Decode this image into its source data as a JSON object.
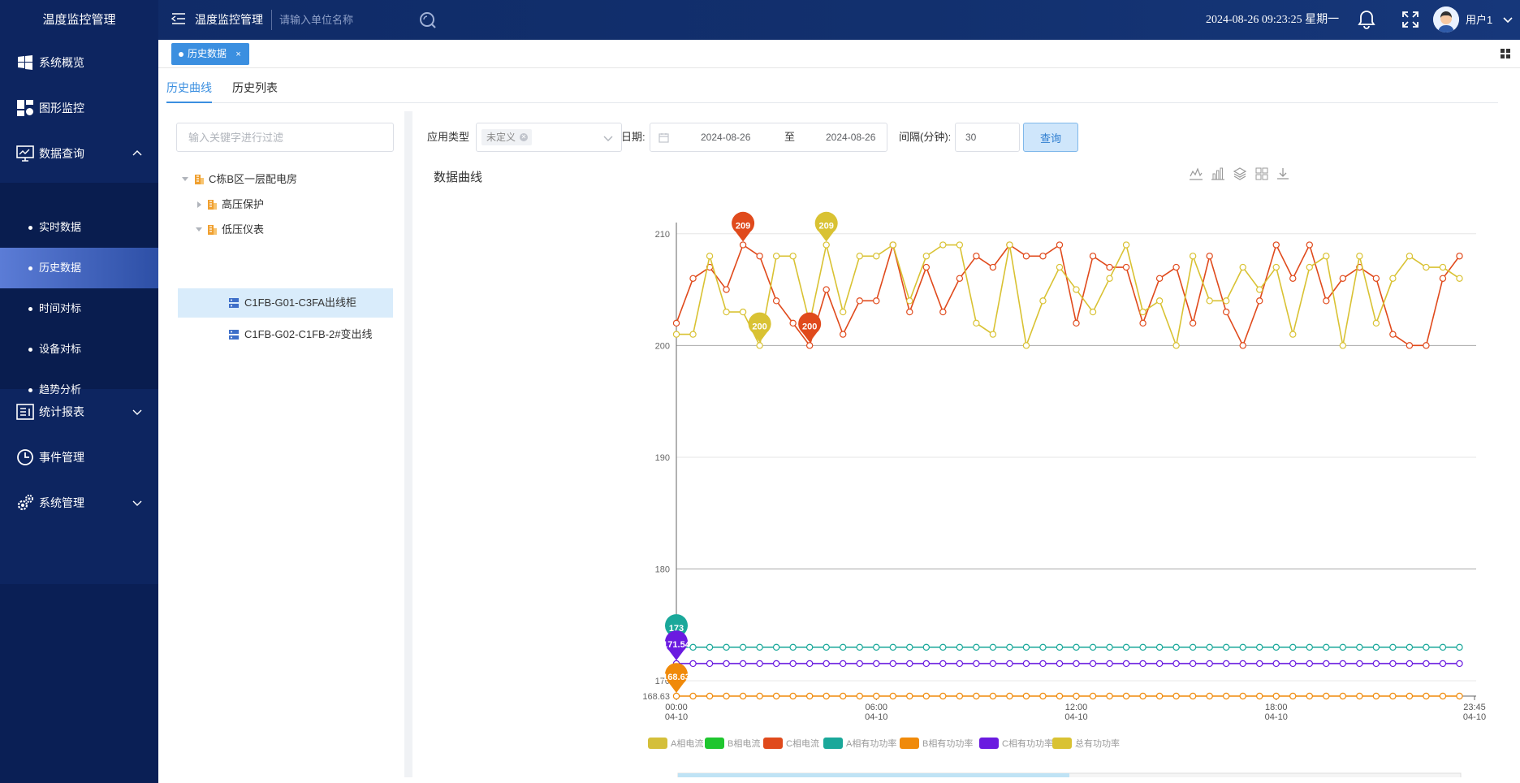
{
  "header": {
    "brand": "温度监控管理",
    "title": "温度监控管理",
    "search_placeholder": "请输入单位名称",
    "datetime": "2024-08-26 09:23:25 星期一",
    "user": "用户1"
  },
  "sidebar": {
    "items": [
      {
        "label": "系统概览",
        "icon": "windows-icon"
      },
      {
        "label": "图形监控",
        "icon": "dashboard-icon"
      },
      {
        "label": "数据查询",
        "icon": "monitor-icon"
      },
      {
        "label": "统计报表",
        "icon": "report-icon"
      },
      {
        "label": "事件管理",
        "icon": "clock-icon"
      },
      {
        "label": "系统管理",
        "icon": "gears-icon"
      }
    ],
    "subitems": [
      "实时数据",
      "历史数据",
      "时间对标",
      "设备对标",
      "趋势分析"
    ],
    "active_sub": 1
  },
  "tags": {
    "active": "历史数据",
    "close": "×"
  },
  "subtabs": [
    "历史曲线",
    "历史列表"
  ],
  "tree": {
    "filter_placeholder": "输入关键字进行过滤",
    "nodes": [
      "C栋B区一层配电房",
      "高压保护",
      "低压仪表",
      "C1FB-G01-C3FA出线柜",
      "C1FB-G02-C1FB-2#变出线"
    ]
  },
  "query": {
    "type_label": "应用类型",
    "type_value": "未定义",
    "date_label": "日期:",
    "date_start": "2024-08-26",
    "date_sep": "至",
    "date_end": "2024-08-26",
    "interval_label": "间隔(分钟):",
    "interval_value": "30",
    "button": "查询"
  },
  "chart_title": "数据曲线",
  "colors": {
    "a_current": "#d4bf3a",
    "b_current": "#1fc62f",
    "c_current": "#e04a1c",
    "a_power": "#1aa89a",
    "b_power": "#f08a0a",
    "c_power": "#6a1be0",
    "total_power": "#d9c233",
    "accent": "#3b8fe0"
  },
  "chart_data": {
    "type": "line",
    "y_ticks": [
      170,
      180,
      190,
      200,
      210
    ],
    "y_min_label": "168.63",
    "ylim": [
      168.63,
      211
    ],
    "x_ticks": [
      {
        "t": "00:00",
        "d": "04-10",
        "idx": 0
      },
      {
        "t": "06:00",
        "d": "04-10",
        "idx": 12
      },
      {
        "t": "12:00",
        "d": "04-10",
        "idx": 24
      },
      {
        "t": "18:00",
        "d": "04-10",
        "idx": 36
      },
      {
        "t": "23:45",
        "d": "04-10",
        "idx": 48
      }
    ],
    "n_points": 48,
    "legend": [
      "A相电流",
      "B相电流",
      "C相电流",
      "A相有功功率",
      "B相有功功率",
      "C相有功功率",
      "总有功功率"
    ],
    "series": [
      {
        "name": "C相电流",
        "color_key": "c_current",
        "values": [
          202,
          206,
          207,
          205,
          209,
          208,
          204,
          202,
          200,
          205,
          201,
          204,
          204,
          209,
          203,
          207,
          203,
          206,
          208,
          207,
          209,
          208,
          208,
          209,
          202,
          208,
          207,
          207,
          202,
          206,
          207,
          202,
          208,
          203,
          200,
          204,
          209,
          206,
          209,
          204,
          206,
          207,
          206,
          201,
          200,
          200,
          206,
          208
        ]
      },
      {
        "name": "总有功功率",
        "color_key": "total_power",
        "values": [
          201,
          201,
          208,
          203,
          203,
          200,
          208,
          208,
          202,
          209,
          203,
          208,
          208,
          209,
          204,
          208,
          209,
          209,
          202,
          201,
          209,
          200,
          204,
          207,
          205,
          203,
          206,
          209,
          203,
          204,
          200,
          208,
          204,
          204,
          207,
          205,
          207,
          201,
          207,
          208,
          200,
          208,
          202,
          206,
          208,
          207,
          207,
          206
        ]
      },
      {
        "name": "A相有功功率",
        "color_key": "a_power",
        "values": [
          173
        ]
      },
      {
        "name": "C相有功功率",
        "color_key": "c_power",
        "values": [
          171.54
        ]
      },
      {
        "name": "B相有功功率",
        "color_key": "b_power",
        "values": [
          168.63
        ]
      }
    ],
    "markers": [
      {
        "label": "209",
        "series": 0,
        "idx": 4
      },
      {
        "label": "200",
        "series": 0,
        "idx": 8
      },
      {
        "label": "209",
        "series": 1,
        "idx": 9
      },
      {
        "label": "200",
        "series": 1,
        "idx": 5
      },
      {
        "label": "173",
        "series": 2,
        "idx": 0
      },
      {
        "label": "171.54",
        "series": 3,
        "idx": 0
      },
      {
        "label": "168.63",
        "series": 4,
        "idx": 0
      }
    ],
    "datazoom_range": [
      0,
      0.5
    ]
  }
}
